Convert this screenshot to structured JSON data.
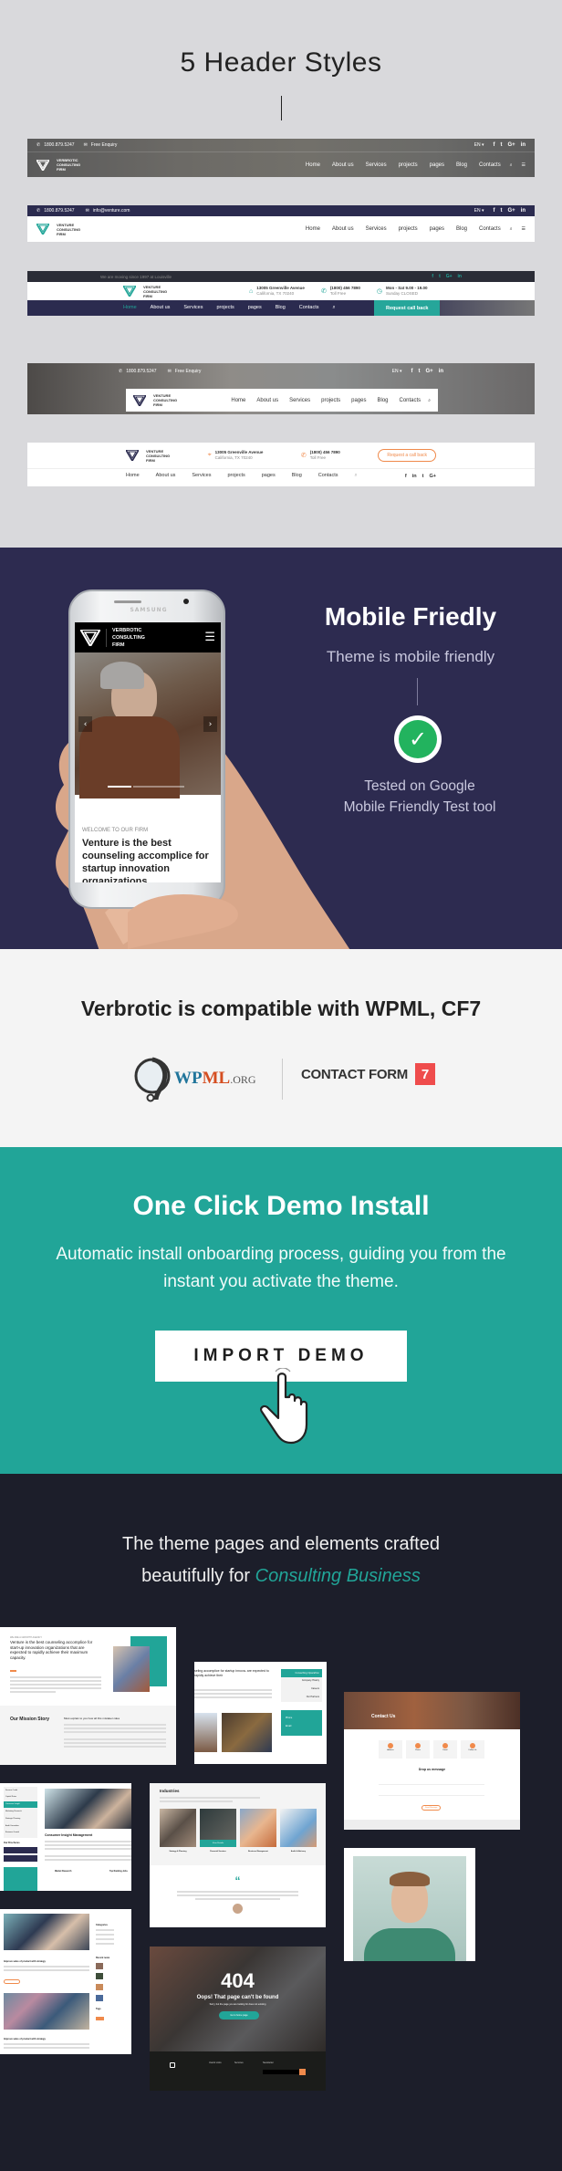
{
  "headers_section": {
    "title": "5 Header Styles",
    "header1": {
      "phone": "1800.879.5247",
      "enquiry": "Free Enquiry",
      "lang": "EN ▾",
      "logo": [
        "VERBROTIC",
        "CONSULTING",
        "FIRM"
      ],
      "nav": [
        "Home",
        "About us",
        "Services",
        "projects",
        "pages",
        "Blog",
        "Contacts"
      ],
      "social": [
        "f",
        "t",
        "G+",
        "in"
      ]
    },
    "header2": {
      "phone": "1800.879.5247",
      "email": "info@venture.com",
      "lang": "EN ▾",
      "logo": [
        "VENTURE",
        "CONSULTING",
        "FIRM"
      ],
      "nav": [
        "Home",
        "About us",
        "Services",
        "projects",
        "pages",
        "Blog",
        "Contacts"
      ],
      "social": [
        "f",
        "t",
        "G+",
        "in"
      ]
    },
    "header3": {
      "notice": "We are moving since 1997 at Louisville",
      "logo": [
        "VENTURE",
        "CONSULTING",
        "FIRM"
      ],
      "address": "13005 Greenville Avenue",
      "address_sub": "California, TX 70240",
      "phone": "(1800) 456 7890",
      "phone_sub": "Toll Free",
      "hours": "Mon - Sat 9.00 - 19.00",
      "hours_sub": "Sunday CLOSED",
      "nav": [
        "Home",
        "About us",
        "Services",
        "projects",
        "pages",
        "Blog",
        "Contacts"
      ],
      "cta": "Request call back",
      "social": [
        "f",
        "t",
        "G+",
        "in"
      ]
    },
    "header4": {
      "phone": "1800.879.5247",
      "enquiry": "Free Enquiry",
      "lang": "EN ▾",
      "logo": [
        "VENTURE",
        "CONSULTING",
        "FIRM"
      ],
      "nav": [
        "Home",
        "About us",
        "Services",
        "projects",
        "pages",
        "Blog",
        "Contacts"
      ],
      "social": [
        "f",
        "t",
        "G+",
        "in"
      ]
    },
    "header5": {
      "logo": [
        "VENTURE",
        "CONSULTING",
        "FIRM"
      ],
      "address": "13005 Greenville Avenue",
      "address_sub": "California, TX 70240",
      "phone": "(1800) 456 7890",
      "phone_sub": "Toll Free",
      "cta": "Request a call back",
      "nav": [
        "Home",
        "About us",
        "Services",
        "projects",
        "pages",
        "Blog",
        "Contacts"
      ],
      "social": [
        "f",
        "in",
        "t",
        "G+"
      ]
    }
  },
  "mobile_section": {
    "title": "Mobile Friedly",
    "subtitle": "Theme is mobile friendly",
    "tested": "Tested on Google",
    "tested2": "Mobile Friendly Test tool",
    "phone_brand": "SAMSUNG",
    "screen": {
      "logo": [
        "VERBROTIC",
        "CONSULTING",
        "FIRM"
      ],
      "welcome": "WELCOME TO OUR FIRM",
      "headline": "Venture is the best counseling accomplice for startup innovation organizations"
    }
  },
  "compat_section": {
    "title": "Verbrotic is compatible with WPML, CF7",
    "wpml": {
      "wp": "WP",
      "ml": "ML",
      "org": ".ORG"
    },
    "cf7": {
      "text": "CONTACT FORM",
      "num": "7"
    }
  },
  "demo_section": {
    "title": "One Click Demo Install",
    "desc": "Automatic install onboarding process, guiding you from the instant you activate the theme.",
    "button": "IMPORT DEMO"
  },
  "pages_section": {
    "title_line1": "The theme pages and elements crafted",
    "title_line2": "beautifully for ",
    "title_accent": "Consulting Business",
    "shots": {
      "about": {
        "eyebrow": "WE ARE A GROWTH AGENCY",
        "headline": "Venture is the best counseling accomplice for start-up innovation organizations that are expected to rapidly achieve their maximum capacity.",
        "mission": "Our Mission Story",
        "mission_sub": "Must explain to you how all this mistaken idea"
      },
      "service": {
        "headline": "seling accomplice for startup innova- are expected to rapidly achieve their",
        "menu": [
          "Consulting Operation",
          "Company History",
          "Careers",
          "Our Partners"
        ],
        "phone_label": "Phone",
        "email_label": "Email"
      },
      "contact": {
        "title": "Contact Us",
        "form_title": "Drop us message",
        "cards": [
          "Address",
          "Phone",
          "Email",
          "Follow Us"
        ],
        "send": "Send Message"
      },
      "service2": {
        "menu": [
          "Finance Credit",
          "Capital Rates",
          "Consumer Insight",
          "Marketing Research",
          "Strategic Planning",
          "Audit Committee",
          "Business Growth"
        ],
        "title": "Consumer Insight Management",
        "brochures": "Our Brochures",
        "f1": "Market Research",
        "f2": "Top Ranking Jobs"
      },
      "industries": {
        "title": "Industries",
        "items": [
          "Strategy & Planning",
          "Financial Services",
          "Business Management",
          "Audit & Advisory"
        ],
        "button": "View Details",
        "quote": "“"
      },
      "blog": {
        "post": "Improve sales of product with strategy",
        "categories": "Categories",
        "recent": "Recent news",
        "tags": "Tags"
      },
      "error": {
        "code": "404",
        "msg": "Oops! That page can't be found",
        "sub": "Sorry, but the page you are looking for does not existing",
        "button": "Go to home page",
        "footer_cols": [
          "Useful Links",
          "Services",
          "Newsletter"
        ]
      }
    }
  },
  "colors": {
    "teal": "#21a598",
    "navy": "#2d2b50",
    "dark": "#1c1e2a",
    "orange": "#f08a4b",
    "green_check": "#22b35e",
    "cf7_red": "#ef4c4c"
  }
}
